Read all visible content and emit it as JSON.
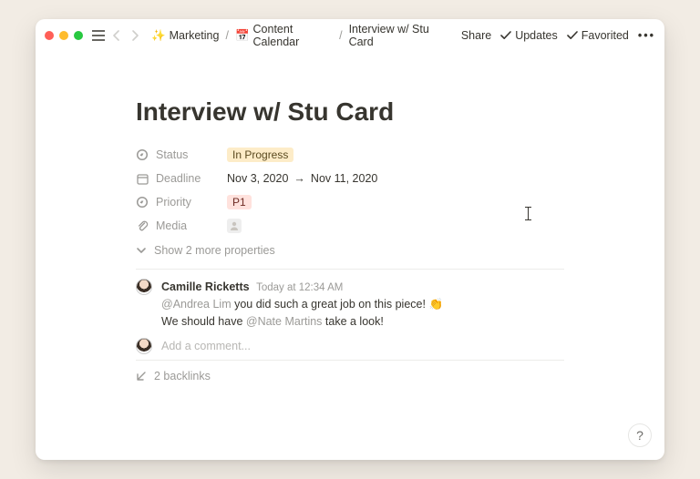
{
  "topbar": {
    "breadcrumbs": [
      {
        "icon": "✨",
        "label": "Marketing"
      },
      {
        "icon": "📅",
        "label": "Content Calendar"
      },
      {
        "icon": "",
        "label": "Interview w/ Stu Card"
      }
    ],
    "share": "Share",
    "updates": "Updates",
    "favorited": "Favorited"
  },
  "page": {
    "title": "Interview w/ Stu Card"
  },
  "properties": {
    "status": {
      "label": "Status",
      "value": "In Progress"
    },
    "deadline": {
      "label": "Deadline",
      "start": "Nov 3, 2020",
      "arrow": "→",
      "end": "Nov 11, 2020"
    },
    "priority": {
      "label": "Priority",
      "value": "P1"
    },
    "media": {
      "label": "Media"
    },
    "show_more": "Show 2 more properties"
  },
  "comments": {
    "author": "Camille Ricketts",
    "time": "Today at 12:34 AM",
    "line1_mention": "@Andrea Lim",
    "line1_text": " you did such a great job on this piece! ",
    "line1_emoji": "👏",
    "line2_prefix": "We should have ",
    "line2_mention": "@Nate Martins",
    "line2_suffix": " take a look!",
    "add_placeholder": "Add a comment..."
  },
  "backlinks": {
    "label": "2 backlinks"
  },
  "help": {
    "label": "?"
  }
}
